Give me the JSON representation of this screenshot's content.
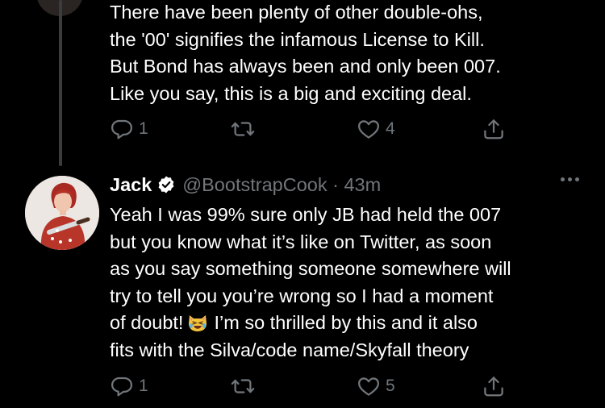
{
  "parent_tweet": {
    "lines": [
      "There have been plenty of other double-ohs,",
      "the '00' signifies the infamous License to Kill.",
      "But Bond has always been and only been 007.",
      "Like you say, this is a big and exciting deal."
    ],
    "reply_count": "1",
    "retweet_count": "",
    "like_count": "4"
  },
  "reply_tweet": {
    "author_name": "Jack",
    "handle_time": "@BootstrapCook · 43m",
    "lines": [
      "Yeah I was 99% sure only JB had held the 007",
      "but you know what it’s like on Twitter, as soon",
      "as you say something someone somewhere will",
      "try to tell you you’re wrong so I had a moment"
    ],
    "line5_before_emoji": "of doubt!",
    "emoji": "laughing-cat-emoji",
    "line5_after_emoji": "I’m so thrilled by this and it also",
    "line6": "fits with the Silva/code name/Skyfall theory",
    "reply_count": "1",
    "retweet_count": "",
    "like_count": "5"
  },
  "colors": {
    "background": "#000000",
    "text": "#ffffff",
    "secondary": "#71767b",
    "verified_badge": "#ffffff",
    "thread_line": "#3a3d40"
  }
}
